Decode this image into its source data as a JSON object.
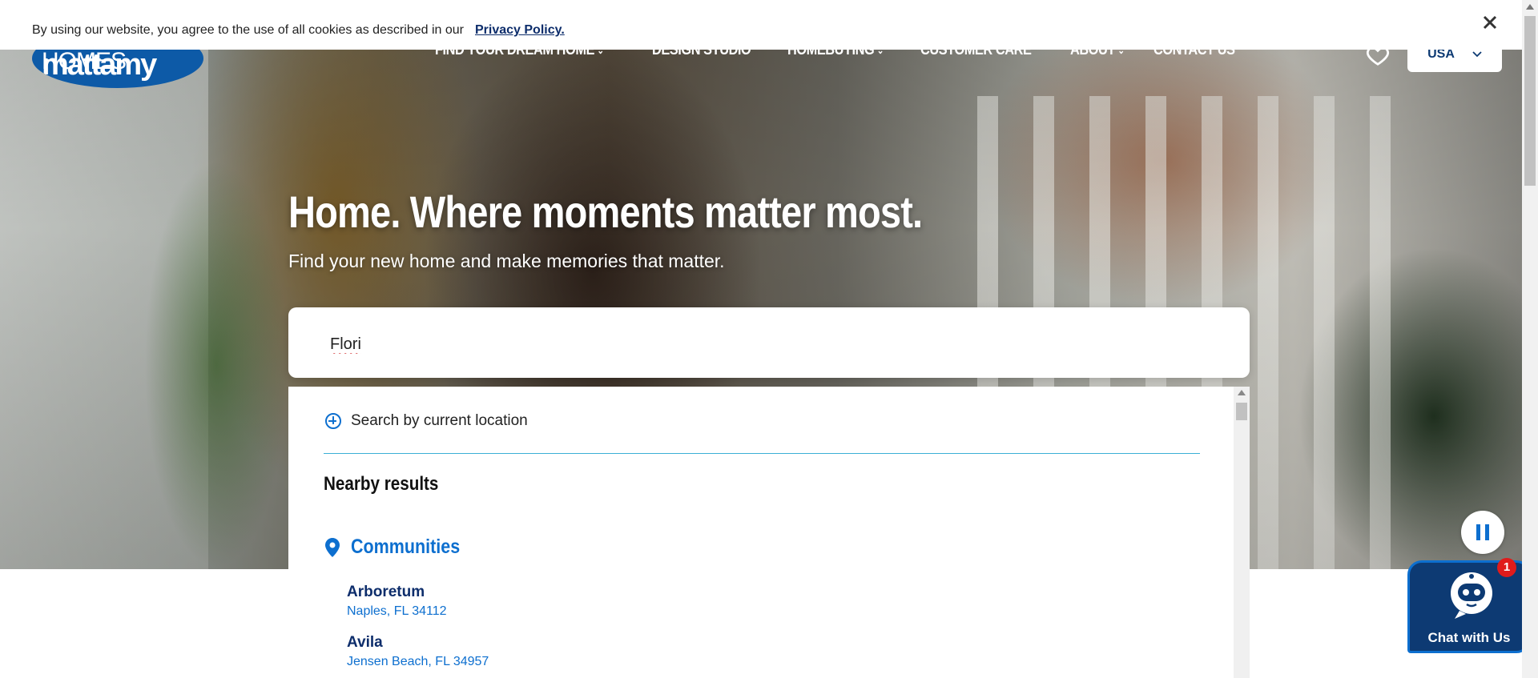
{
  "cookie_bar": {
    "text": "By using our website, you agree to the use of all cookies as described in our",
    "link": "Privacy Policy.",
    "close_icon": "close-icon"
  },
  "header": {
    "logo": "mattamyHOMES",
    "nav": [
      {
        "label": "FIND YOUR DREAM HOME",
        "dropdown": true
      },
      {
        "label": "DESIGN STUDIO",
        "dropdown": false
      },
      {
        "label": "HOMEBUYING",
        "dropdown": true
      },
      {
        "label": "CUSTOMER CARE",
        "dropdown": false
      },
      {
        "label": "ABOUT",
        "dropdown": true
      },
      {
        "label": "CONTACT US",
        "dropdown": false
      }
    ],
    "favorites_icon": "heart-icon",
    "country": "USA"
  },
  "hero": {
    "headline": "Home. Where moments matter most.",
    "subhead": "Find your new home and make memories that matter."
  },
  "search": {
    "value": "Flori"
  },
  "dropdown": {
    "location_label": "Search by current location",
    "nearby_label": "Nearby results",
    "communities_label": "Communities",
    "communities": [
      {
        "name": "Arboretum",
        "address": "Naples, FL 34112"
      },
      {
        "name": "Avila",
        "address": "Jensen Beach, FL 34957"
      }
    ]
  },
  "chat": {
    "label": "Chat with Us",
    "badge": "1"
  },
  "colors": {
    "brand_blue": "#0d6fcf",
    "navy": "#0d2d6b"
  }
}
